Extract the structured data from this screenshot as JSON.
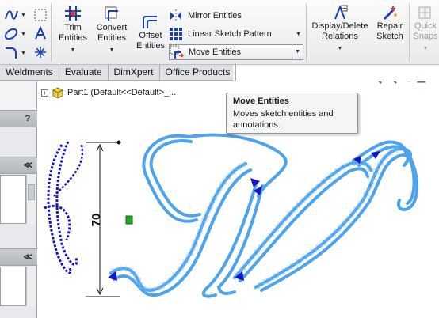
{
  "ribbon": {
    "trim": {
      "line1": "Trim",
      "line2": "Entities"
    },
    "convert": {
      "line1": "Convert",
      "line2": "Entities"
    },
    "offset": {
      "line1": "Offset",
      "line2": "Entities"
    },
    "rows": {
      "mirror": "Mirror Entities",
      "linear_pattern": "Linear Sketch Pattern",
      "move": "Move Entities"
    },
    "display_delete": {
      "line1": "Display/Delete",
      "line2": "Relations"
    },
    "repair": {
      "line1": "Repair",
      "line2": "Sketch"
    },
    "quick_snaps": {
      "line1": "Quick",
      "line2": "Snaps"
    }
  },
  "tabs": [
    "Weldments",
    "Evaluate",
    "DimXpert",
    "Office Products"
  ],
  "left_panel": {
    "help_label": "?",
    "collapse_label": "≪"
  },
  "tree": {
    "part_label": "Part1  (Default<<Default>_..."
  },
  "tooltip": {
    "title": "Move Entities",
    "description_line1": "Moves sketch entities and",
    "description_line2": "annotations."
  },
  "dimension": {
    "value": "70"
  },
  "colors": {
    "sketch": "#4ea4ec",
    "accent": "#1414c8",
    "relation": "#22aa22"
  }
}
